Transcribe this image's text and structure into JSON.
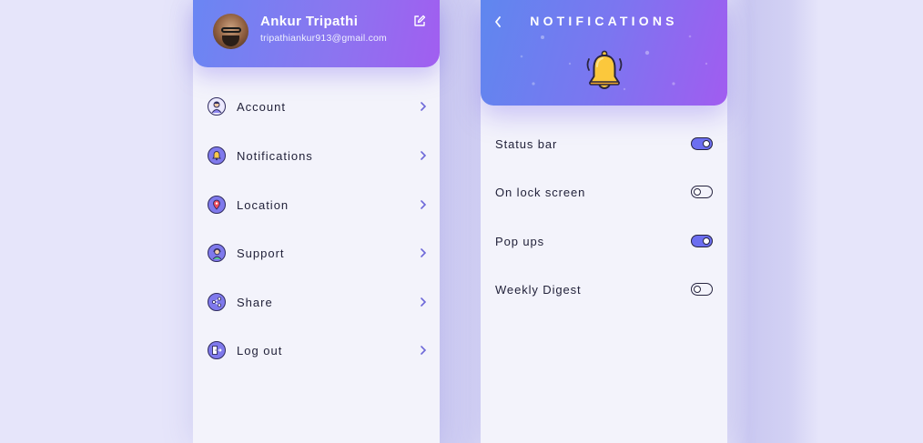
{
  "profile": {
    "name": "Ankur Tripathi",
    "email": "tripathiankur913@gmail.com",
    "avatar_icon": "user-avatar",
    "edit_icon": "edit-icon"
  },
  "menu": {
    "items": [
      {
        "label": "Account",
        "icon": "account-icon"
      },
      {
        "label": "Notifications",
        "icon": "bell-icon"
      },
      {
        "label": "Location",
        "icon": "location-pin-icon"
      },
      {
        "label": "Support",
        "icon": "support-agent-icon"
      },
      {
        "label": "Share",
        "icon": "share-icon"
      },
      {
        "label": "Log out",
        "icon": "logout-icon"
      }
    ],
    "chevron_icon": "chevron-right-icon"
  },
  "notifications": {
    "title": "NOTIFICATIONS",
    "back_icon": "chevron-left-icon",
    "header_icon": "ringing-bell-icon",
    "settings": [
      {
        "label": "Status bar",
        "enabled": true
      },
      {
        "label": "On lock screen",
        "enabled": false
      },
      {
        "label": "Pop ups",
        "enabled": true
      },
      {
        "label": "Weekly Digest",
        "enabled": false
      }
    ]
  },
  "colors": {
    "background": "#e6e5fa",
    "gradient_start": "#6a86f3",
    "gradient_end": "#a15ef0",
    "toggle_on": "#6c6ef0",
    "text_dark": "#22223a"
  }
}
